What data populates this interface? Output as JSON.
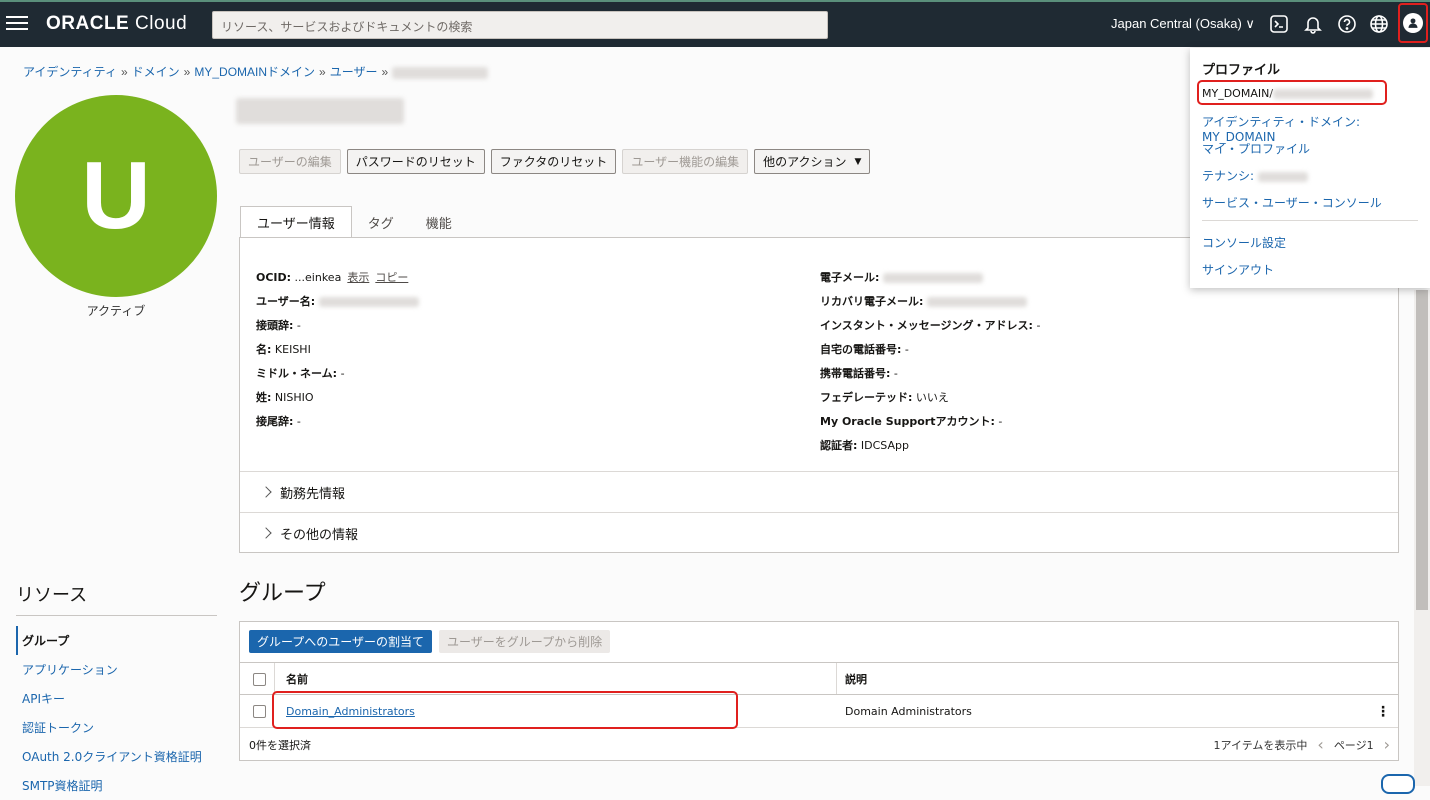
{
  "header": {
    "logo_brand": "ORACLE",
    "logo_product": "Cloud",
    "search_placeholder": "リソース、サービスおよびドキュメントの検索",
    "region": "Japan Central (Osaka)",
    "region_chevron": "∨"
  },
  "breadcrumb": {
    "items": [
      "アイデンティティ",
      "ドメイン",
      "MY_DOMAINドメイン",
      "ユーザー"
    ],
    "separator": "»"
  },
  "user": {
    "avatar_letter": "U",
    "status": "アクティブ",
    "avatar_color": "#7ab31e"
  },
  "actions": {
    "edit_user": "ユーザーの編集",
    "reset_password": "パスワードのリセット",
    "reset_factors": "ファクタのリセット",
    "edit_capabilities": "ユーザー機能の編集",
    "more_actions": "他のアクション"
  },
  "tabs": [
    "ユーザー情報",
    "タグ",
    "機能"
  ],
  "info_left": {
    "ocid_label": "OCID:",
    "ocid_value": "...einkea",
    "ocid_show": "表示",
    "ocid_copy": "コピー",
    "username_label": "ユーザー名:",
    "prefix_label": "接頭辞:",
    "prefix_value": "-",
    "first_name_label": "名:",
    "first_name_value": "KEISHI",
    "middle_name_label": "ミドル・ネーム:",
    "middle_name_value": "-",
    "last_name_label": "姓:",
    "last_name_value": "NISHIO",
    "suffix_label": "接尾辞:",
    "suffix_value": "-"
  },
  "info_right": {
    "email_label": "電子メール:",
    "recovery_email_label": "リカバリ電子メール:",
    "im_label": "インスタント・メッセージング・アドレス:",
    "im_value": "-",
    "home_phone_label": "自宅の電話番号:",
    "home_phone_value": "-",
    "mobile_label": "携帯電話番号:",
    "mobile_value": "-",
    "federated_label": "フェデレーテッド:",
    "federated_value": "いいえ",
    "mos_label": "My Oracle Supportアカウント:",
    "mos_value": "-",
    "authenticator_label": "認証者:",
    "authenticator_value": "IDCSApp"
  },
  "sections": {
    "work_info": "勤務先情報",
    "other_info": "その他の情報"
  },
  "resources": {
    "title": "リソース",
    "items": [
      "グループ",
      "アプリケーション",
      "APIキー",
      "認証トークン",
      "OAuth 2.0クライアント資格証明",
      "SMTP資格証明"
    ]
  },
  "groups": {
    "title": "グループ",
    "assign_button": "グループへのユーザーの割当て",
    "remove_button": "ユーザーをグループから削除",
    "columns": [
      "名前",
      "説明"
    ],
    "rows": [
      {
        "name": "Domain_Administrators",
        "description": "Domain Administrators"
      }
    ],
    "selected_count": "0件を選択済",
    "items_shown": "1アイテムを表示中",
    "page_label": "ページ1"
  },
  "profile_menu": {
    "heading": "プロファイル",
    "domain_user": "MY_DOMAIN/",
    "identity_domain": "アイデンティティ・ドメイン: MY_DOMAIN",
    "my_profile": "マイ・プロファイル",
    "tenancy": "テナンシ:",
    "service_user_console": "サービス・ユーザー・コンソール",
    "console_settings": "コンソール設定",
    "sign_out": "サインアウト"
  },
  "colors": {
    "accent": "#1b66ad",
    "topbar": "#1f2a33",
    "highlight": "#e0201e"
  }
}
